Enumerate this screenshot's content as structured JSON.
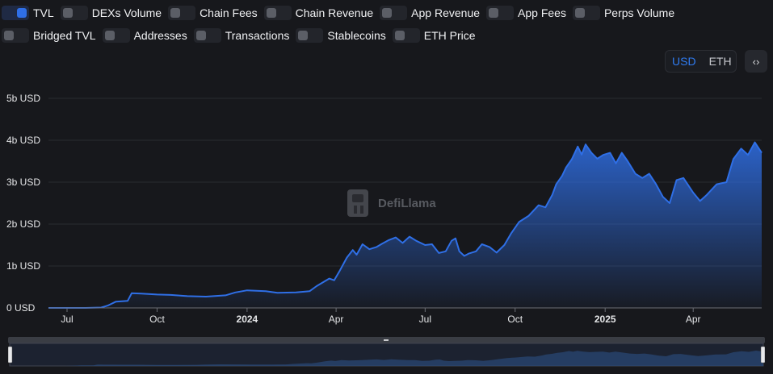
{
  "toggles": [
    [
      {
        "label": "TVL",
        "on": true
      },
      {
        "label": "DEXs Volume",
        "on": false
      },
      {
        "label": "Chain Fees",
        "on": false
      },
      {
        "label": "Chain Revenue",
        "on": false
      },
      {
        "label": "App Revenue",
        "on": false
      },
      {
        "label": "App Fees",
        "on": false
      },
      {
        "label": "Perps Volume",
        "on": false
      }
    ],
    [
      {
        "label": "Bridged TVL",
        "on": false
      },
      {
        "label": "Addresses",
        "on": false
      },
      {
        "label": "Transactions",
        "on": false
      },
      {
        "label": "Stablecoins",
        "on": false
      },
      {
        "label": "ETH Price",
        "on": false
      }
    ]
  ],
  "currency": {
    "options": [
      "USD",
      "ETH"
    ],
    "selected": "USD"
  },
  "embed_icon": "code-icon",
  "watermark": "DefiLlama",
  "colors": {
    "series": "#2f6fe6",
    "background": "#17181c",
    "grid": "#2a2c31"
  },
  "chart_data": {
    "type": "area",
    "title": "",
    "xlabel": "",
    "ylabel": "",
    "ylim": [
      0,
      5
    ],
    "yunit": "b USD",
    "y_tick_labels": [
      "0 USD",
      "1b USD",
      "2b USD",
      "3b USD",
      "4b USD",
      "5b USD"
    ],
    "y_ticks": [
      0,
      1,
      2,
      3,
      4,
      5
    ],
    "x_tick_labels": [
      {
        "label": "Jul",
        "date": "2023-07-01",
        "bold": false
      },
      {
        "label": "Oct",
        "date": "2023-10-01",
        "bold": false
      },
      {
        "label": "2024",
        "date": "2024-01-01",
        "bold": true
      },
      {
        "label": "Apr",
        "date": "2024-04-01",
        "bold": false
      },
      {
        "label": "Jul",
        "date": "2024-07-01",
        "bold": false
      },
      {
        "label": "Oct",
        "date": "2024-10-01",
        "bold": false
      },
      {
        "label": "2025",
        "date": "2025-01-01",
        "bold": true
      },
      {
        "label": "Apr",
        "date": "2025-04-01",
        "bold": false
      }
    ],
    "xlim": [
      "2023-06-12",
      "2025-06-10"
    ],
    "grid": true,
    "legend": "none",
    "series": [
      {
        "name": "TVL",
        "unit": "b USD",
        "points": [
          [
            "2023-06-12",
            0.0
          ],
          [
            "2023-07-20",
            0.0
          ],
          [
            "2023-08-05",
            0.01
          ],
          [
            "2023-08-12",
            0.06
          ],
          [
            "2023-08-20",
            0.15
          ],
          [
            "2023-09-01",
            0.17
          ],
          [
            "2023-09-05",
            0.35
          ],
          [
            "2023-09-15",
            0.34
          ],
          [
            "2023-10-01",
            0.32
          ],
          [
            "2023-10-15",
            0.31
          ],
          [
            "2023-11-01",
            0.28
          ],
          [
            "2023-11-20",
            0.27
          ],
          [
            "2023-12-10",
            0.3
          ],
          [
            "2023-12-20",
            0.37
          ],
          [
            "2024-01-01",
            0.42
          ],
          [
            "2024-01-20",
            0.4
          ],
          [
            "2024-02-01",
            0.36
          ],
          [
            "2024-02-20",
            0.37
          ],
          [
            "2024-03-05",
            0.4
          ],
          [
            "2024-03-12",
            0.52
          ],
          [
            "2024-03-25",
            0.7
          ],
          [
            "2024-03-30",
            0.66
          ],
          [
            "2024-04-05",
            0.9
          ],
          [
            "2024-04-12",
            1.2
          ],
          [
            "2024-04-18",
            1.38
          ],
          [
            "2024-04-22",
            1.27
          ],
          [
            "2024-04-28",
            1.52
          ],
          [
            "2024-05-05",
            1.4
          ],
          [
            "2024-05-12",
            1.45
          ],
          [
            "2024-05-18",
            1.53
          ],
          [
            "2024-05-25",
            1.62
          ],
          [
            "2024-06-01",
            1.68
          ],
          [
            "2024-06-08",
            1.55
          ],
          [
            "2024-06-15",
            1.7
          ],
          [
            "2024-06-22",
            1.6
          ],
          [
            "2024-07-01",
            1.5
          ],
          [
            "2024-07-08",
            1.52
          ],
          [
            "2024-07-15",
            1.31
          ],
          [
            "2024-07-22",
            1.35
          ],
          [
            "2024-07-28",
            1.6
          ],
          [
            "2024-08-01",
            1.66
          ],
          [
            "2024-08-05",
            1.35
          ],
          [
            "2024-08-10",
            1.24
          ],
          [
            "2024-08-15",
            1.3
          ],
          [
            "2024-08-22",
            1.35
          ],
          [
            "2024-08-28",
            1.52
          ],
          [
            "2024-09-05",
            1.45
          ],
          [
            "2024-09-12",
            1.32
          ],
          [
            "2024-09-20",
            1.5
          ],
          [
            "2024-09-27",
            1.78
          ],
          [
            "2024-10-05",
            2.05
          ],
          [
            "2024-10-15",
            2.2
          ],
          [
            "2024-10-25",
            2.45
          ],
          [
            "2024-11-01",
            2.4
          ],
          [
            "2024-11-08",
            2.7
          ],
          [
            "2024-11-12",
            2.95
          ],
          [
            "2024-11-18",
            3.15
          ],
          [
            "2024-11-22",
            3.35
          ],
          [
            "2024-11-28",
            3.55
          ],
          [
            "2024-12-04",
            3.85
          ],
          [
            "2024-12-08",
            3.66
          ],
          [
            "2024-12-12",
            3.9
          ],
          [
            "2024-12-18",
            3.7
          ],
          [
            "2024-12-24",
            3.56
          ],
          [
            "2024-12-30",
            3.65
          ],
          [
            "2025-01-06",
            3.7
          ],
          [
            "2025-01-12",
            3.45
          ],
          [
            "2025-01-18",
            3.7
          ],
          [
            "2025-01-24",
            3.5
          ],
          [
            "2025-02-01",
            3.2
          ],
          [
            "2025-02-08",
            3.1
          ],
          [
            "2025-02-15",
            3.2
          ],
          [
            "2025-02-22",
            2.95
          ],
          [
            "2025-03-01",
            2.65
          ],
          [
            "2025-03-08",
            2.5
          ],
          [
            "2025-03-15",
            3.05
          ],
          [
            "2025-03-22",
            3.1
          ],
          [
            "2025-04-01",
            2.75
          ],
          [
            "2025-04-08",
            2.55
          ],
          [
            "2025-04-15",
            2.7
          ],
          [
            "2025-04-25",
            2.95
          ],
          [
            "2025-05-05",
            3.0
          ],
          [
            "2025-05-12",
            3.55
          ],
          [
            "2025-05-20",
            3.8
          ],
          [
            "2025-05-27",
            3.65
          ],
          [
            "2025-06-03",
            3.95
          ],
          [
            "2025-06-10",
            3.7
          ]
        ]
      }
    ]
  }
}
